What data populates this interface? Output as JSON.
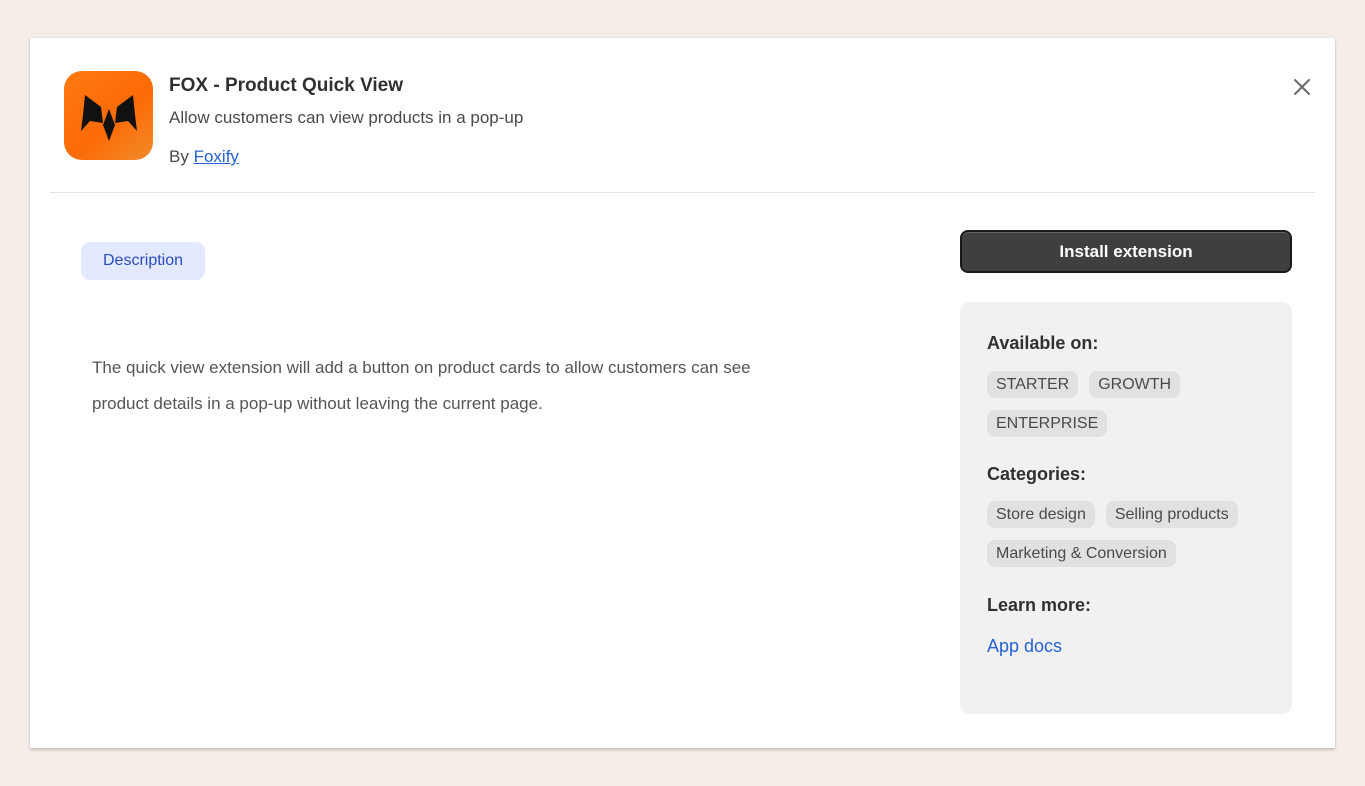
{
  "app": {
    "title": "FOX - Product Quick View",
    "subtitle": "Allow customers can view products in a pop-up",
    "by_prefix": "By",
    "developer": "Foxify",
    "icon": "fox-logo-icon"
  },
  "header": {
    "close_icon": "close-icon"
  },
  "tabs": [
    {
      "label": "Description",
      "active": true
    }
  ],
  "description": {
    "line1": "The quick view extension will add a button on product cards to allow customers can see",
    "line2": "product details in a pop-up without leaving the current page."
  },
  "install_button": {
    "label": "Install extension"
  },
  "sidebar": {
    "available_heading": "Available on:",
    "plans": [
      "STARTER",
      "GROWTH",
      "ENTERPRISE"
    ],
    "categories_heading": "Categories:",
    "categories": [
      "Store design",
      "Selling products",
      "Marketing & Conversion"
    ],
    "learn_heading": "Learn more:",
    "docs_link": "App docs"
  },
  "colors": {
    "page_background": "#f5ede8",
    "icon_orange": "#fb6a06",
    "link_blue": "#2463d1",
    "tab_active_bg": "#e3e9ff",
    "button_dark": "#3f3f3f"
  }
}
